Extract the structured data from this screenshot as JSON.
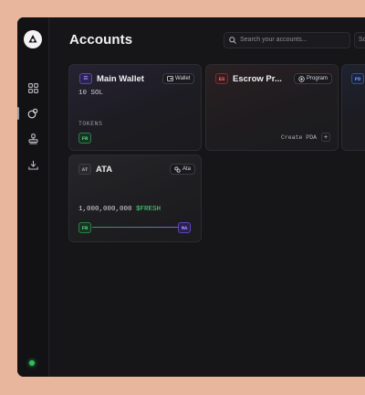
{
  "page": {
    "title": "Accounts"
  },
  "search": {
    "placeholder": "Search your accounts...",
    "secondary_label": "Sc"
  },
  "cards": {
    "main_wallet": {
      "badge": "≡",
      "title": "Main Wallet",
      "type_label": "Wallet",
      "balance": "10 SOL",
      "tokens_label": "TOKENS",
      "token_badge": "FR"
    },
    "escrow": {
      "badge": "ES",
      "title": "Escrow Pr...",
      "type_label": "Program",
      "action_label": "Create PDA",
      "action_icon": "+"
    },
    "pd": {
      "badge": "PD"
    },
    "ata": {
      "badge": "AT",
      "title": "ATA",
      "type_label": "Ata",
      "amount": "1,000,000,000",
      "token_symbol": "$FRESH",
      "flow_from": "FR",
      "flow_to": "MA"
    }
  },
  "colors": {
    "accent_purple": "#8b6cf0",
    "token_green": "#4ade80",
    "escrow_red": "#e24c4c",
    "pd_blue": "#4f7dde",
    "status_green": "#2fbf5b"
  },
  "icons": [
    "logo-icon",
    "grid-icon",
    "accounts-icon",
    "stamp-icon",
    "download-icon",
    "search-icon",
    "wallet-icon",
    "program-icon",
    "ata-icon",
    "plus-icon"
  ]
}
